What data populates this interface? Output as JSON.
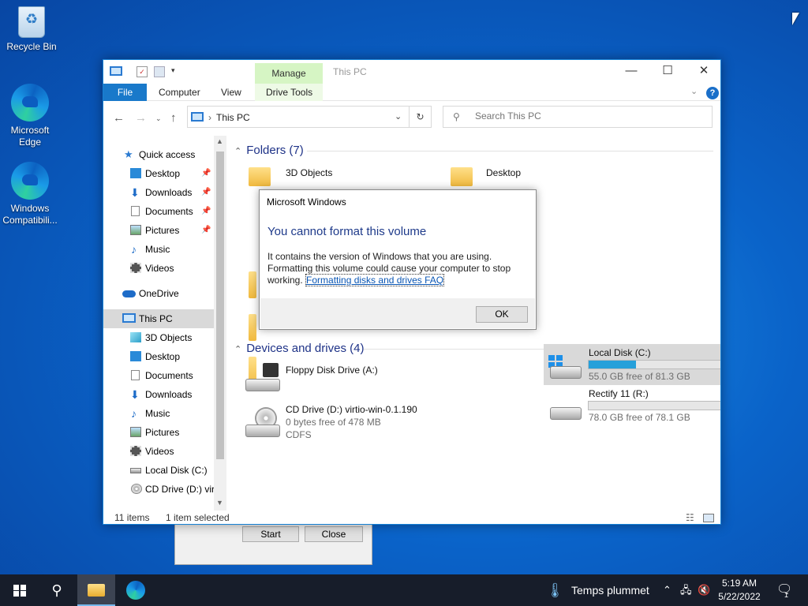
{
  "desktop": {
    "icons": [
      {
        "label": "Recycle Bin",
        "icon": "recycle-bin-icon"
      },
      {
        "label": "Microsoft Edge",
        "icon": "edge-icon"
      },
      {
        "label": "Windows Compatibili...",
        "icon": "edge-icon"
      }
    ]
  },
  "background_dialog": {
    "start_label": "Start",
    "close_label": "Close"
  },
  "explorer": {
    "title": "This PC",
    "manage_label": "Manage",
    "ribbon_tabs": {
      "file": "File",
      "computer": "Computer",
      "view": "View",
      "drive_tools": "Drive Tools"
    },
    "address": {
      "crumb": "This PC"
    },
    "search": {
      "placeholder": "Search This PC"
    },
    "nav": {
      "quick_access": "Quick access",
      "qa_items": [
        {
          "label": "Desktop",
          "icon": "desktop-icon",
          "pinned": true
        },
        {
          "label": "Downloads",
          "icon": "download-icon",
          "pinned": true
        },
        {
          "label": "Documents",
          "icon": "documents-icon",
          "pinned": true
        },
        {
          "label": "Pictures",
          "icon": "pictures-icon",
          "pinned": true
        },
        {
          "label": "Music",
          "icon": "music-icon",
          "pinned": false
        },
        {
          "label": "Videos",
          "icon": "videos-icon",
          "pinned": false
        }
      ],
      "onedrive": "OneDrive",
      "this_pc": "This PC",
      "pc_items": [
        {
          "label": "3D Objects",
          "icon": "3d-objects-icon"
        },
        {
          "label": "Desktop",
          "icon": "desktop-icon"
        },
        {
          "label": "Documents",
          "icon": "documents-icon"
        },
        {
          "label": "Downloads",
          "icon": "download-icon"
        },
        {
          "label": "Music",
          "icon": "music-icon"
        },
        {
          "label": "Pictures",
          "icon": "pictures-icon"
        },
        {
          "label": "Videos",
          "icon": "videos-icon"
        },
        {
          "label": "Local Disk (C:)",
          "icon": "drive-icon"
        },
        {
          "label": "CD Drive (D:) virt",
          "icon": "cd-drive-icon"
        }
      ]
    },
    "folders_header": "Folders (7)",
    "folders": [
      "3D Objects",
      "Desktop"
    ],
    "devices_header": "Devices and drives (4)",
    "drives": [
      {
        "name": "Floppy Disk Drive (A:)",
        "detail": "",
        "fs": "",
        "used_fraction": null
      },
      {
        "name": "Local Disk (C:)",
        "detail": "55.0 GB free of 81.3 GB",
        "fs": "",
        "used_fraction": 0.32
      },
      {
        "name": "CD Drive (D:) virtio-win-0.1.190",
        "detail": "0 bytes free of 478 MB",
        "fs": "CDFS",
        "used_fraction": null
      },
      {
        "name": "Rectify 11 (R:)",
        "detail": "78.0 GB free of 78.1 GB",
        "fs": "",
        "used_fraction": 0.0
      }
    ],
    "status": {
      "items": "11 items",
      "selected": "1 item selected"
    }
  },
  "message_dialog": {
    "title": "Microsoft Windows",
    "heading": "You cannot format this volume",
    "body": "It contains the version of Windows that you are using. Formatting this volume could cause your computer to stop working.",
    "link": "Formatting disks and drives FAQ",
    "ok_label": "OK"
  },
  "taskbar": {
    "weather": "Temps plummet",
    "time": "5:19 AM",
    "date": "5/22/2022",
    "notification_count": "1"
  },
  "colors": {
    "accent": "#1979ca",
    "manage_tab": "#d6f5c4",
    "dialog_heading": "#1e3a8a",
    "bar_fill": "#26a0da"
  }
}
